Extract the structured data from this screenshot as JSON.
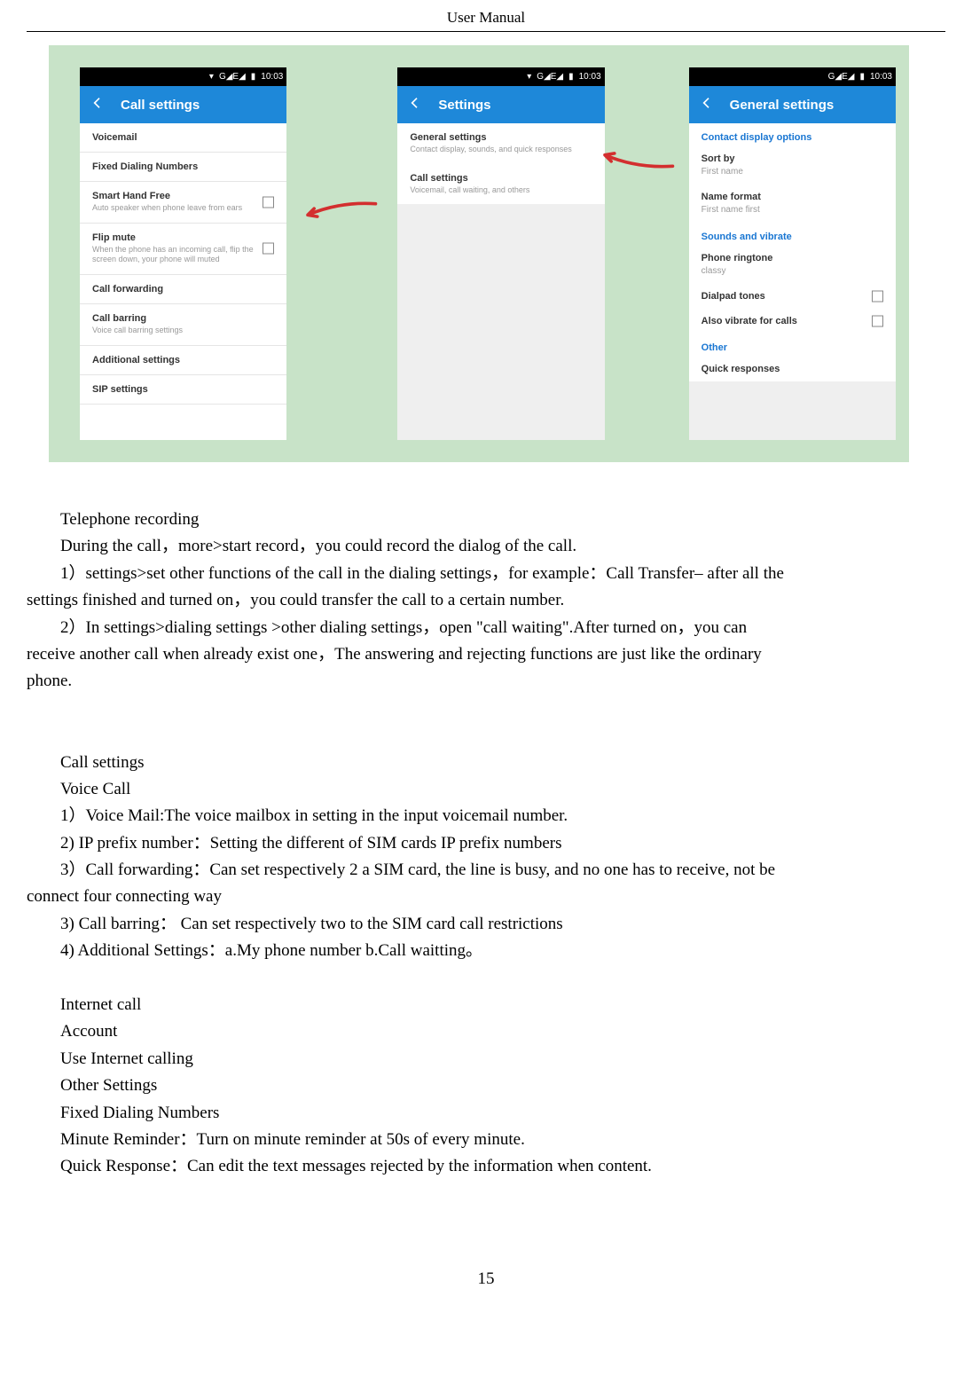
{
  "header": "User    Manual",
  "page_number": "15",
  "status": {
    "signal": "G◢E◢",
    "battery": "▮",
    "time": "10:03",
    "wifi": "▾"
  },
  "phone1": {
    "title": "Call settings",
    "items": [
      {
        "title": "Voicemail",
        "sub": "",
        "checkbox": false
      },
      {
        "title": "Fixed Dialing Numbers",
        "sub": "",
        "checkbox": false
      },
      {
        "title": "Smart Hand Free",
        "sub": "Auto speaker when phone leave from ears",
        "checkbox": true
      },
      {
        "title": "Flip mute",
        "sub": "When the phone has an incoming call, flip the screen down, your phone will muted",
        "checkbox": true
      },
      {
        "title": "Call forwarding",
        "sub": "",
        "checkbox": false
      },
      {
        "title": "Call barring",
        "sub": "Voice call barring settings",
        "checkbox": false
      },
      {
        "title": "Additional settings",
        "sub": "",
        "checkbox": false
      },
      {
        "title": "SIP settings",
        "sub": "",
        "checkbox": false
      }
    ]
  },
  "phone2": {
    "title": "Settings",
    "items": [
      {
        "title": "General settings",
        "sub": "Contact display, sounds, and quick responses"
      },
      {
        "title": "Call settings",
        "sub": "Voicemail, call waiting, and others"
      }
    ]
  },
  "phone3": {
    "title": "General settings",
    "sections": {
      "contact": "Contact display options",
      "sounds": "Sounds and vibrate",
      "other": "Other"
    },
    "items": {
      "sort_by": {
        "title": "Sort by",
        "sub": "First name"
      },
      "name_format": {
        "title": "Name format",
        "sub": "First name first"
      },
      "ringtone": {
        "title": "Phone ringtone",
        "sub": "classy"
      },
      "dialpad": {
        "title": "Dialpad tones",
        "checkbox": true
      },
      "vibrate": {
        "title": "Also vibrate for calls",
        "checkbox": true
      },
      "quick": {
        "title": "Quick responses"
      }
    }
  },
  "text": {
    "tel_rec": "Telephone recording",
    "during": "During the call，more>start record，you could record the dialog of the call.",
    "p1a": "  1）settings>set other functions of the call in the dialing settings，for example：Call Transfer– after all the",
    "p1b": "settings finished and turned on，you could transfer the call to a certain number.",
    "p2a": "2）In settings>dialing settings >other dialing settings，open  \"call waiting\".After turned on，you can",
    "p2b": "receive another call when already exist one，The answering and rejecting functions are just like the ordinary",
    "p2c": "phone.",
    "call_settings": "Call settings",
    "voice_call": "Voice Call",
    "vc1": "1）Voice Mail:The voice mailbox in setting in the input voicemail number.",
    "vc2": "2) IP prefix number：Setting the different of SIM cards IP prefix numbers",
    "vc3a": "  3）Call forwarding：Can set respectively 2 a SIM card, the line is busy, and no one has to receive, not be",
    "vc3b": "connect four connecting way",
    "vc4": "3) Call barring：  Can set respectively two to the SIM card call restrictions",
    "vc5": "4) Additional Settings：a.My phone number b.Call waitting。",
    "internet": "Internet call",
    "account": "Account",
    "use_internet": "Use Internet calling",
    "other_settings": "Other Settings",
    "fdn": "Fixed Dialing Numbers",
    "minute": "Minute Reminder：Turn on minute reminder at 50s of every minute.",
    "quick": "Quick Response：Can edit the text messages rejected by the information when content."
  }
}
